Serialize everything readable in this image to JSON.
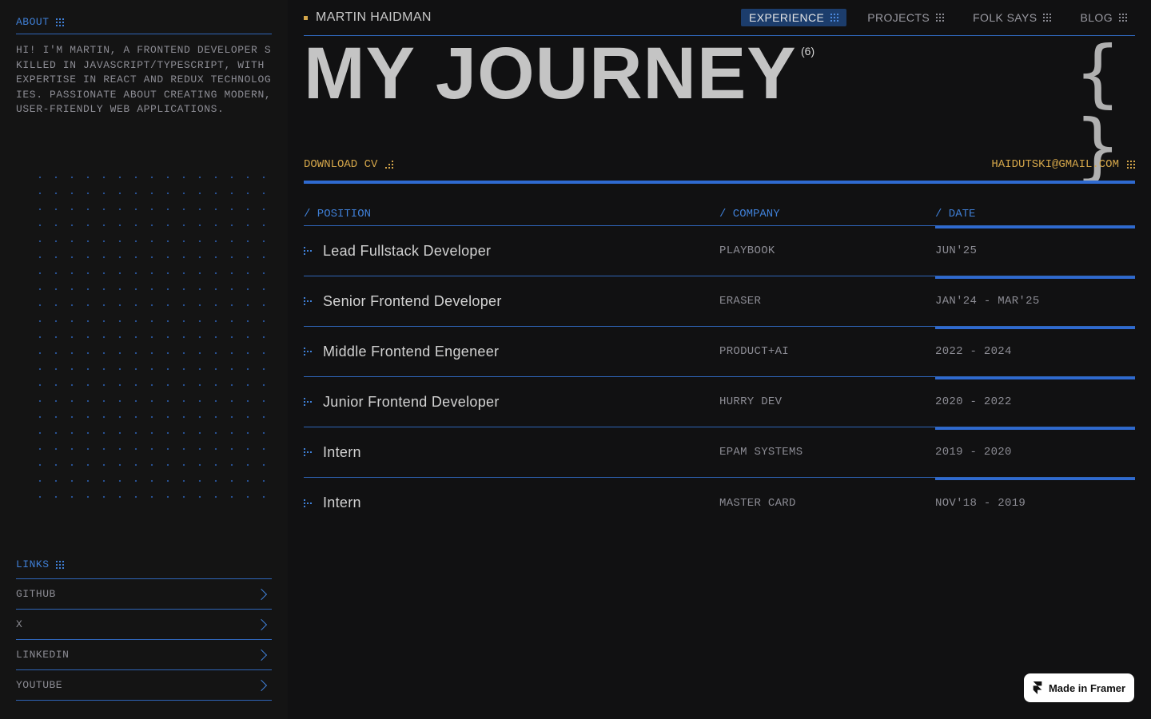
{
  "sidebar": {
    "about_heading": "ABOUT",
    "about_text": "HI! I'M MARTIN, A FRONTEND DEVELOPER SKILLED IN JAVASCRIPT/TYPESCRIPT, WITH EXPERTISE IN REACT AND REDUX TECHNOLOGIES. PASSIONATE ABOUT CREATING MODERN, USER-FRIENDLY WEB APPLICATIONS.",
    "links_heading": "LINKS",
    "links": [
      {
        "label": "GITHUB"
      },
      {
        "label": "X"
      },
      {
        "label": "LINKEDIN"
      },
      {
        "label": "YOUTUBE"
      }
    ]
  },
  "header": {
    "brand": "MARTIN HAIDMAN",
    "nav": [
      {
        "label": "EXPERIENCE",
        "active": true
      },
      {
        "label": "PROJECTS",
        "active": false
      },
      {
        "label": "FOLK SAYS",
        "active": false
      },
      {
        "label": "BLOG",
        "active": false
      }
    ]
  },
  "hero": {
    "title": "MY JOURNEY",
    "count": "(6)",
    "braces": "{ }"
  },
  "cv": {
    "download_label": "DOWNLOAD CV",
    "email": "HAIDUTSKI@GMAIL.COM"
  },
  "table": {
    "headers": {
      "position": "/ POSITION",
      "company": "/ COMPANY",
      "date": "/ DATE"
    },
    "rows": [
      {
        "position": "Lead Fullstack Developer",
        "company": "PLAYBOOK",
        "date": "JUN'25"
      },
      {
        "position": "Senior Frontend Developer",
        "company": "ERASER",
        "date": "JAN'24 - MAR'25"
      },
      {
        "position": "Middle Frontend Engeneer",
        "company": "PRODUCT+AI",
        "date": "2022 - 2024"
      },
      {
        "position": "Junior Frontend Developer",
        "company": "HURRY DEV",
        "date": "2020 - 2022"
      },
      {
        "position": "Intern",
        "company": "EPAM SYSTEMS",
        "date": "2019 - 2020"
      },
      {
        "position": "Intern",
        "company": "MASTER CARD",
        "date": "NOV'18 - 2019"
      }
    ]
  },
  "badge": {
    "label": "Made in Framer"
  },
  "colors": {
    "accent_blue": "#2f6ad0",
    "accent_gold": "#d4a64a",
    "background": "#111112"
  }
}
